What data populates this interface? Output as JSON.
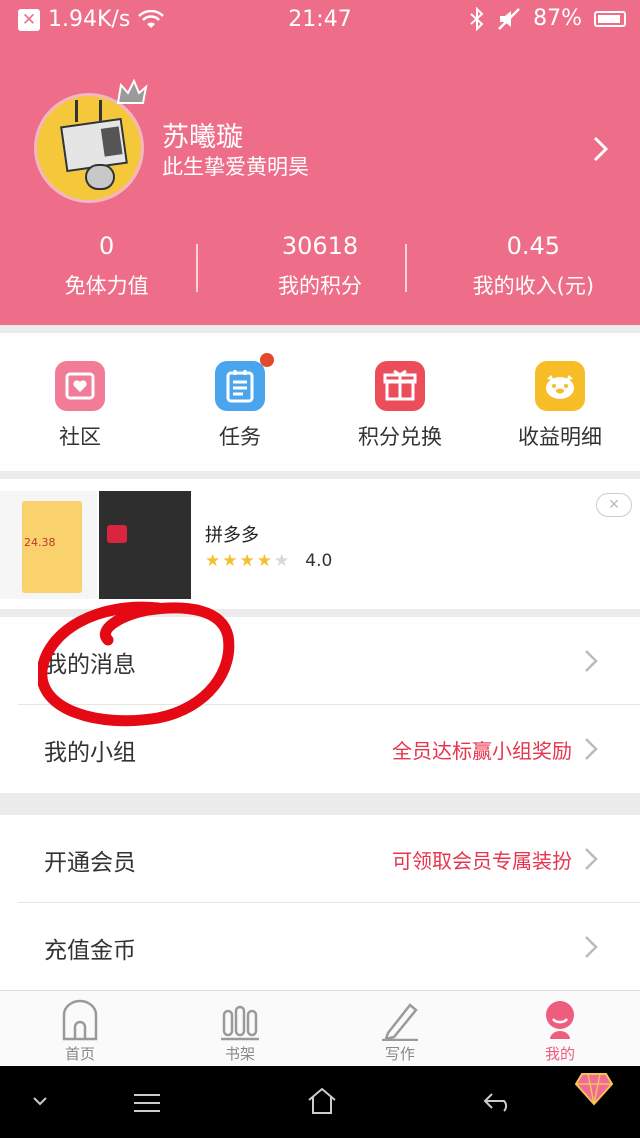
{
  "status": {
    "speed": "1.94K/s",
    "time": "21:47",
    "battery": "87%"
  },
  "profile": {
    "name": "苏曦璇",
    "signature": "此生挚爱黄明昊"
  },
  "stats": [
    {
      "value": "0",
      "label": "免体力值"
    },
    {
      "value": "30618",
      "label": "我的积分"
    },
    {
      "value": "0.45",
      "label": "我的收入(元)"
    }
  ],
  "quick": [
    {
      "label": "社区",
      "icon": "community-icon",
      "color": "#f27b97"
    },
    {
      "label": "任务",
      "icon": "task-clipboard-icon",
      "color": "#4aa4ee"
    },
    {
      "label": "积分兑换",
      "icon": "gift-icon",
      "color": "#ec4d5a"
    },
    {
      "label": "收益明细",
      "icon": "piggy-bank-icon",
      "color": "#f6bd26"
    }
  ],
  "ad": {
    "title": "拼多多",
    "rating": "4.0",
    "stars_filled": 4,
    "stars_total": 5,
    "thumb_amount": "24.38"
  },
  "menu_group1": [
    {
      "title": "我的消息",
      "hint": ""
    },
    {
      "title": "我的小组",
      "hint": "全员达标赢小组奖励"
    }
  ],
  "menu_group2": [
    {
      "title": "开通会员",
      "hint": "可领取会员专属装扮"
    },
    {
      "title": "充值金币",
      "hint": ""
    }
  ],
  "tabs": [
    {
      "label": "首页",
      "icon": "home-icon"
    },
    {
      "label": "书架",
      "icon": "bookshelf-icon"
    },
    {
      "label": "写作",
      "icon": "pen-icon"
    },
    {
      "label": "我的",
      "icon": "profile-icon",
      "active": true
    }
  ],
  "colors": {
    "brand_pink": "#ee6e8a",
    "hint_red": "#e8344d",
    "annotation_red": "#e50914"
  }
}
